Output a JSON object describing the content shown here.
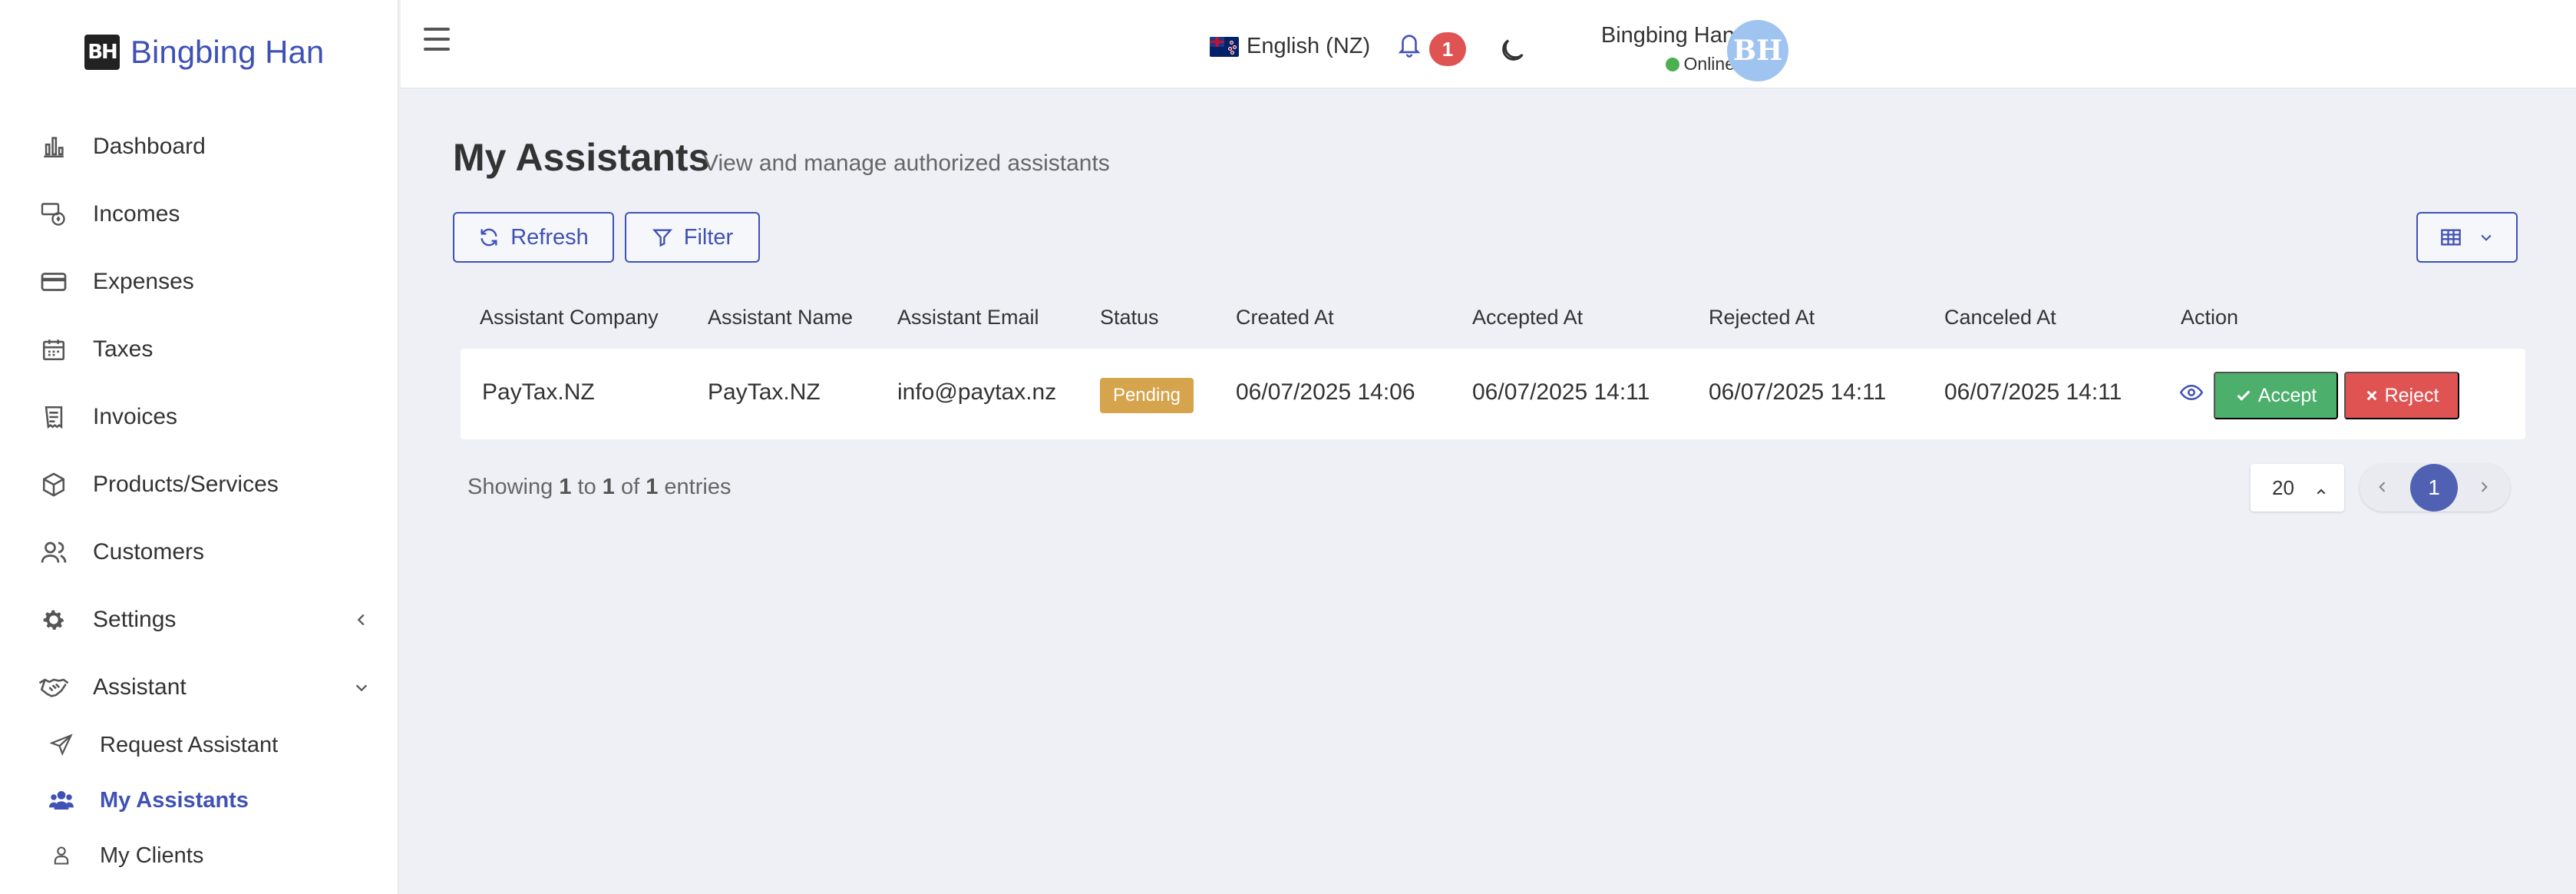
{
  "brand": {
    "name": "Bingbing Han",
    "logo_text": "BH"
  },
  "sidebar": {
    "items": [
      {
        "label": "Dashboard",
        "icon": "bar-chart-icon"
      },
      {
        "label": "Incomes",
        "icon": "income-icon"
      },
      {
        "label": "Expenses",
        "icon": "credit-card-icon"
      },
      {
        "label": "Taxes",
        "icon": "calendar-icon"
      },
      {
        "label": "Invoices",
        "icon": "invoice-icon"
      },
      {
        "label": "Products/Services",
        "icon": "box-icon"
      },
      {
        "label": "Customers",
        "icon": "users-icon"
      },
      {
        "label": "Settings",
        "icon": "gear-icon"
      },
      {
        "label": "Assistant",
        "icon": "handshake-icon"
      }
    ],
    "sub_items": [
      {
        "label": "Request Assistant",
        "icon": "paper-plane-icon"
      },
      {
        "label": "My Assistants",
        "icon": "user-group-icon",
        "active": true
      },
      {
        "label": "My Clients",
        "icon": "user-icon"
      }
    ]
  },
  "topbar": {
    "language": "English (NZ)",
    "notification_count": "1",
    "user_name": "Bingbing Han",
    "user_status": "Online",
    "avatar_initials": "BH"
  },
  "page": {
    "title": "My Assistants",
    "subtitle": "View and manage authorized assistants",
    "refresh_label": "Refresh",
    "filter_label": "Filter"
  },
  "table": {
    "columns": [
      "Assistant Company",
      "Assistant Name",
      "Assistant Email",
      "Status",
      "Created At",
      "Accepted At",
      "Rejected At",
      "Canceled At",
      "Action"
    ],
    "rows": [
      {
        "company": "PayTax.NZ",
        "name": "PayTax.NZ",
        "email": "info@paytax.nz",
        "status": "Pending",
        "created_at": "06/07/2025 14:06",
        "accepted_at": "06/07/2025 14:11",
        "rejected_at": "06/07/2025 14:11",
        "canceled_at": "06/07/2025 14:11",
        "accept_label": "Accept",
        "reject_label": "Reject"
      }
    ]
  },
  "footer": {
    "showing_prefix": "Showing",
    "from": "1",
    "to_word": "to",
    "to": "1",
    "of_word": "of",
    "total": "1",
    "entries_word": "entries",
    "per_page": "20",
    "current_page": "1"
  },
  "colors": {
    "primary": "#3f51b5",
    "pending": "#d5a44c",
    "accept": "#4caf6b",
    "reject": "#e05353",
    "online": "#4caf50"
  }
}
